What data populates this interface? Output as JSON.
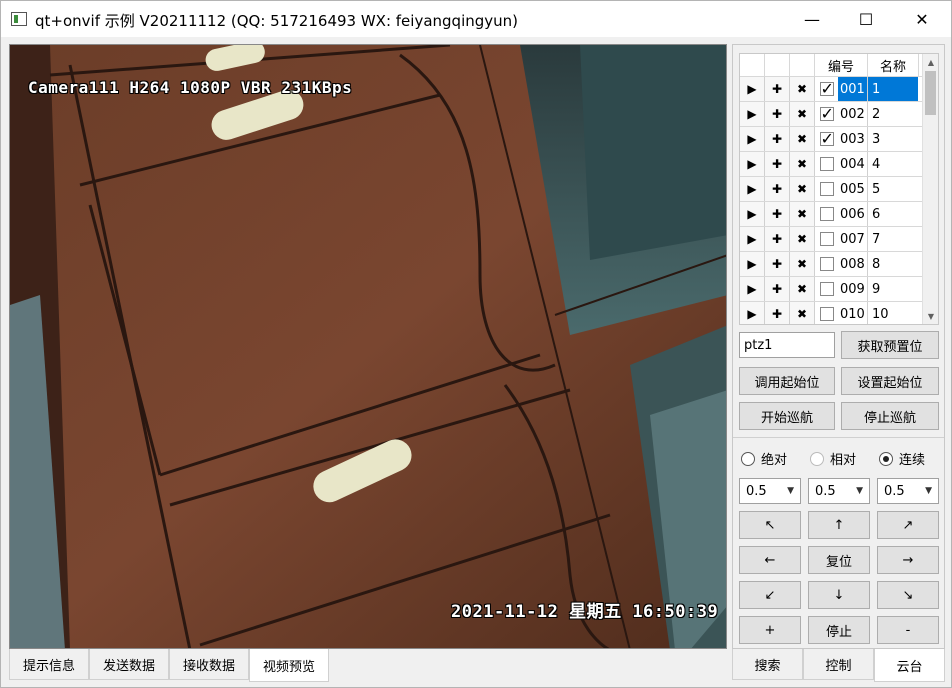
{
  "window": {
    "title": "qt+onvif 示例 V20211112 (QQ: 517216493 WX: feiyangqingyun)",
    "min_glyph": "—",
    "max_glyph": "☐",
    "close_glyph": "✕"
  },
  "video": {
    "osd_top": "Camera111 H264 1080P VBR 231KBps",
    "osd_bottom": "2021-11-12  星期五  16:50:39"
  },
  "bottom_tabs": [
    "提示信息",
    "发送数据",
    "接收数据",
    "视频预览"
  ],
  "table": {
    "headers": [
      "编号",
      "名称"
    ],
    "btn_glyphs": [
      "▶",
      "✚",
      "✖"
    ],
    "rows": [
      {
        "num": "001",
        "name": "1",
        "checked": true,
        "selected": true
      },
      {
        "num": "002",
        "name": "2",
        "checked": true,
        "selected": false
      },
      {
        "num": "003",
        "name": "3",
        "checked": true,
        "selected": false
      },
      {
        "num": "004",
        "name": "4",
        "checked": false,
        "selected": false
      },
      {
        "num": "005",
        "name": "5",
        "checked": false,
        "selected": false
      },
      {
        "num": "006",
        "name": "6",
        "checked": false,
        "selected": false
      },
      {
        "num": "007",
        "name": "7",
        "checked": false,
        "selected": false
      },
      {
        "num": "008",
        "name": "8",
        "checked": false,
        "selected": false
      },
      {
        "num": "009",
        "name": "9",
        "checked": false,
        "selected": false
      },
      {
        "num": "010",
        "name": "10",
        "checked": false,
        "selected": false
      }
    ]
  },
  "preset": {
    "input_value": "ptz1",
    "get_preset": "获取预置位",
    "call_start": "调用起始位",
    "set_start": "设置起始位",
    "start_cruise": "开始巡航",
    "stop_cruise": "停止巡航"
  },
  "mode": {
    "absolute": "绝对",
    "relative": "相对",
    "continuous": "连续",
    "selected": "continuous"
  },
  "speeds": [
    "0.5",
    "0.5",
    "0.5"
  ],
  "ptz": {
    "up_left": "↖",
    "up": "↑",
    "up_right": "↗",
    "left": "←",
    "reset": "复位",
    "right": "→",
    "down_left": "↙",
    "down": "↓",
    "down_right": "↘",
    "zoom_in": "+",
    "stop": "停止",
    "zoom_out": "-"
  },
  "panel_tabs": [
    "搜索",
    "控制",
    "云台"
  ],
  "active_panel_tab": "云台",
  "active_bottom_tab": "视频预览"
}
